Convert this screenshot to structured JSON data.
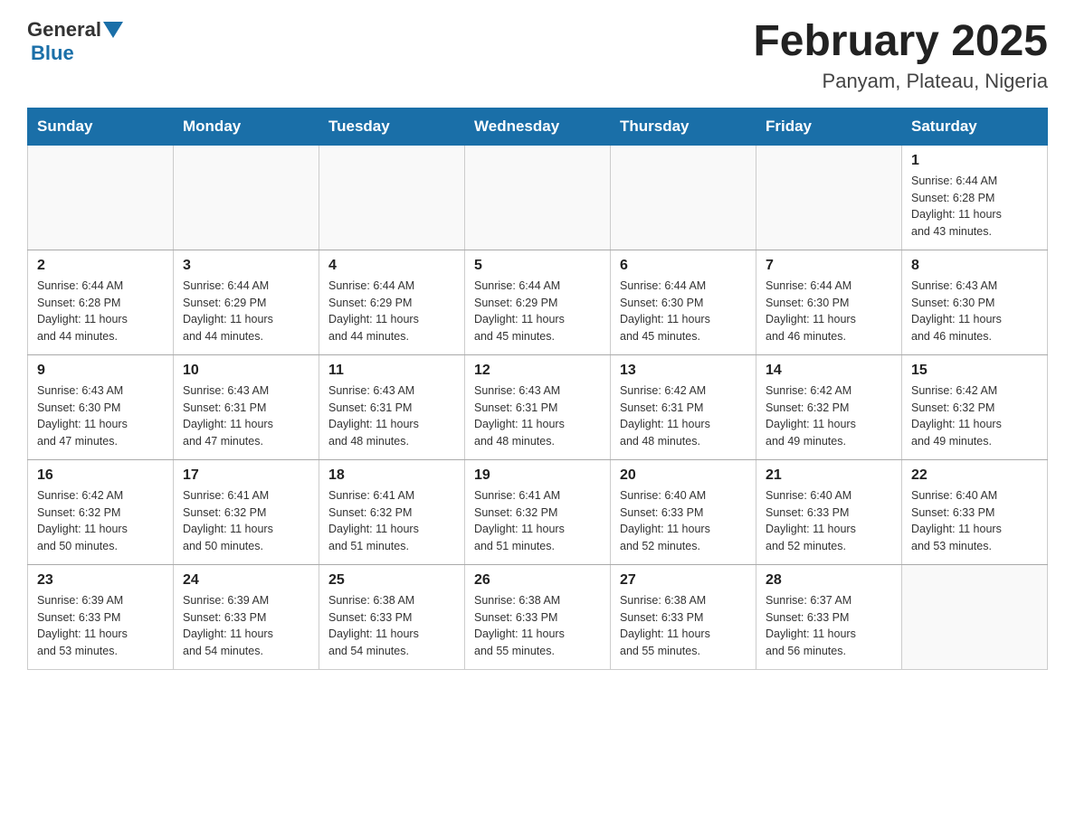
{
  "header": {
    "logo_general": "General",
    "logo_blue": "Blue",
    "month_year": "February 2025",
    "location": "Panyam, Plateau, Nigeria"
  },
  "weekdays": [
    "Sunday",
    "Monday",
    "Tuesday",
    "Wednesday",
    "Thursday",
    "Friday",
    "Saturday"
  ],
  "weeks": [
    [
      {
        "day": "",
        "info": ""
      },
      {
        "day": "",
        "info": ""
      },
      {
        "day": "",
        "info": ""
      },
      {
        "day": "",
        "info": ""
      },
      {
        "day": "",
        "info": ""
      },
      {
        "day": "",
        "info": ""
      },
      {
        "day": "1",
        "info": "Sunrise: 6:44 AM\nSunset: 6:28 PM\nDaylight: 11 hours\nand 43 minutes."
      }
    ],
    [
      {
        "day": "2",
        "info": "Sunrise: 6:44 AM\nSunset: 6:28 PM\nDaylight: 11 hours\nand 44 minutes."
      },
      {
        "day": "3",
        "info": "Sunrise: 6:44 AM\nSunset: 6:29 PM\nDaylight: 11 hours\nand 44 minutes."
      },
      {
        "day": "4",
        "info": "Sunrise: 6:44 AM\nSunset: 6:29 PM\nDaylight: 11 hours\nand 44 minutes."
      },
      {
        "day": "5",
        "info": "Sunrise: 6:44 AM\nSunset: 6:29 PM\nDaylight: 11 hours\nand 45 minutes."
      },
      {
        "day": "6",
        "info": "Sunrise: 6:44 AM\nSunset: 6:30 PM\nDaylight: 11 hours\nand 45 minutes."
      },
      {
        "day": "7",
        "info": "Sunrise: 6:44 AM\nSunset: 6:30 PM\nDaylight: 11 hours\nand 46 minutes."
      },
      {
        "day": "8",
        "info": "Sunrise: 6:43 AM\nSunset: 6:30 PM\nDaylight: 11 hours\nand 46 minutes."
      }
    ],
    [
      {
        "day": "9",
        "info": "Sunrise: 6:43 AM\nSunset: 6:30 PM\nDaylight: 11 hours\nand 47 minutes."
      },
      {
        "day": "10",
        "info": "Sunrise: 6:43 AM\nSunset: 6:31 PM\nDaylight: 11 hours\nand 47 minutes."
      },
      {
        "day": "11",
        "info": "Sunrise: 6:43 AM\nSunset: 6:31 PM\nDaylight: 11 hours\nand 48 minutes."
      },
      {
        "day": "12",
        "info": "Sunrise: 6:43 AM\nSunset: 6:31 PM\nDaylight: 11 hours\nand 48 minutes."
      },
      {
        "day": "13",
        "info": "Sunrise: 6:42 AM\nSunset: 6:31 PM\nDaylight: 11 hours\nand 48 minutes."
      },
      {
        "day": "14",
        "info": "Sunrise: 6:42 AM\nSunset: 6:32 PM\nDaylight: 11 hours\nand 49 minutes."
      },
      {
        "day": "15",
        "info": "Sunrise: 6:42 AM\nSunset: 6:32 PM\nDaylight: 11 hours\nand 49 minutes."
      }
    ],
    [
      {
        "day": "16",
        "info": "Sunrise: 6:42 AM\nSunset: 6:32 PM\nDaylight: 11 hours\nand 50 minutes."
      },
      {
        "day": "17",
        "info": "Sunrise: 6:41 AM\nSunset: 6:32 PM\nDaylight: 11 hours\nand 50 minutes."
      },
      {
        "day": "18",
        "info": "Sunrise: 6:41 AM\nSunset: 6:32 PM\nDaylight: 11 hours\nand 51 minutes."
      },
      {
        "day": "19",
        "info": "Sunrise: 6:41 AM\nSunset: 6:32 PM\nDaylight: 11 hours\nand 51 minutes."
      },
      {
        "day": "20",
        "info": "Sunrise: 6:40 AM\nSunset: 6:33 PM\nDaylight: 11 hours\nand 52 minutes."
      },
      {
        "day": "21",
        "info": "Sunrise: 6:40 AM\nSunset: 6:33 PM\nDaylight: 11 hours\nand 52 minutes."
      },
      {
        "day": "22",
        "info": "Sunrise: 6:40 AM\nSunset: 6:33 PM\nDaylight: 11 hours\nand 53 minutes."
      }
    ],
    [
      {
        "day": "23",
        "info": "Sunrise: 6:39 AM\nSunset: 6:33 PM\nDaylight: 11 hours\nand 53 minutes."
      },
      {
        "day": "24",
        "info": "Sunrise: 6:39 AM\nSunset: 6:33 PM\nDaylight: 11 hours\nand 54 minutes."
      },
      {
        "day": "25",
        "info": "Sunrise: 6:38 AM\nSunset: 6:33 PM\nDaylight: 11 hours\nand 54 minutes."
      },
      {
        "day": "26",
        "info": "Sunrise: 6:38 AM\nSunset: 6:33 PM\nDaylight: 11 hours\nand 55 minutes."
      },
      {
        "day": "27",
        "info": "Sunrise: 6:38 AM\nSunset: 6:33 PM\nDaylight: 11 hours\nand 55 minutes."
      },
      {
        "day": "28",
        "info": "Sunrise: 6:37 AM\nSunset: 6:33 PM\nDaylight: 11 hours\nand 56 minutes."
      },
      {
        "day": "",
        "info": ""
      }
    ]
  ]
}
